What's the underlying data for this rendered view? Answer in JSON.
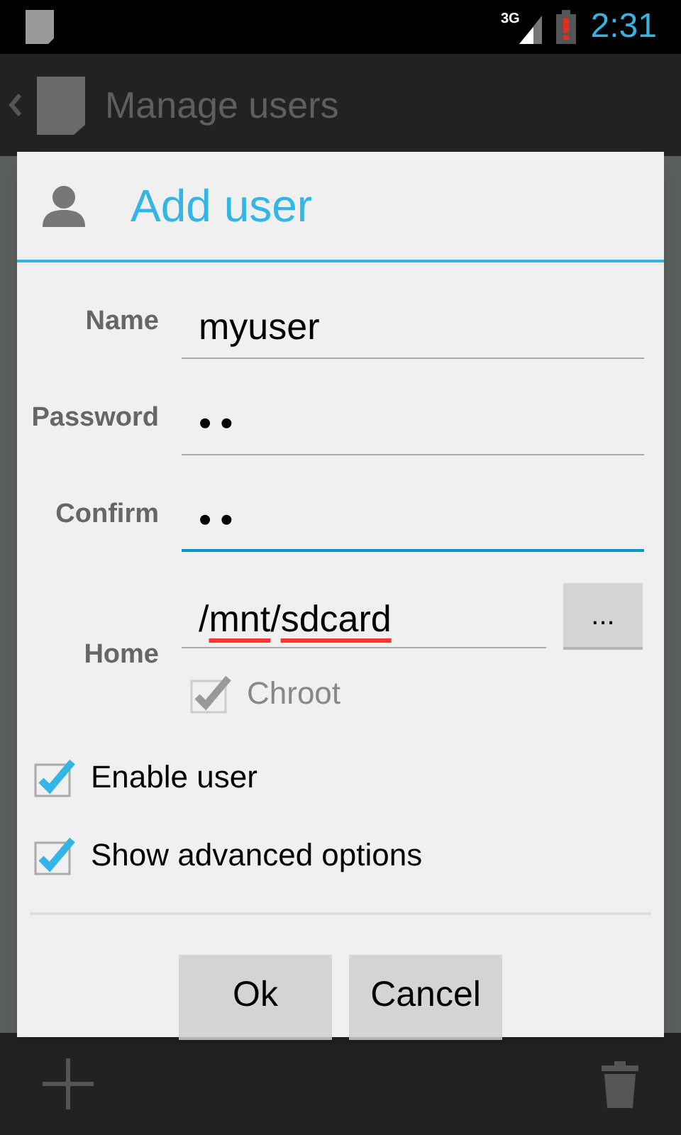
{
  "status_bar": {
    "network": "3G",
    "time": "2:31"
  },
  "action_bar": {
    "title": "Manage users"
  },
  "dialog": {
    "title": "Add user",
    "fields": [
      {
        "label": "Name",
        "value": "myuser",
        "focused": false
      },
      {
        "label": "Password",
        "value": "••",
        "focused": false
      },
      {
        "label": "Confirm",
        "value": "••",
        "focused": true
      }
    ],
    "home": {
      "label": "Home",
      "segments": [
        {
          "text": "/",
          "misspelled": false
        },
        {
          "text": "mnt",
          "misspelled": true
        },
        {
          "text": "/",
          "misspelled": false
        },
        {
          "text": "sdcard",
          "misspelled": true
        }
      ],
      "browse_button": "...",
      "chroot": {
        "label": "Chroot",
        "checked": true,
        "disabled": true
      }
    },
    "options": [
      {
        "label": "Enable user",
        "checked": true,
        "disabled": false
      },
      {
        "label": "Show advanced options",
        "checked": true,
        "disabled": false
      }
    ],
    "buttons": [
      "Ok",
      "Cancel"
    ]
  }
}
